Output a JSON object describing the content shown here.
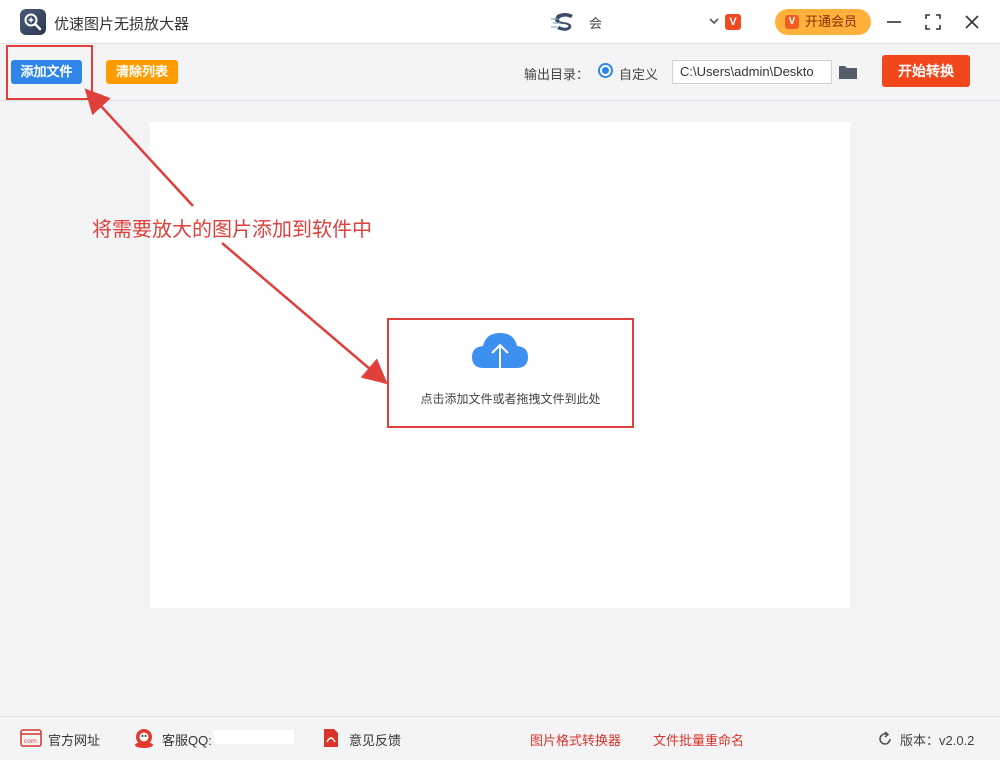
{
  "window": {
    "title": "优速图片无损放大器",
    "user_name": "会",
    "vip_button": "开通会员",
    "vip_icon_letter": "V",
    "badge_letter": "V"
  },
  "toolbar": {
    "add_files": "添加文件",
    "clear_list": "清除列表",
    "output_dir_label": "输出目录：",
    "radio_custom": "自定义",
    "output_path": "C:\\Users\\admin\\Deskto",
    "start_button": "开始转换"
  },
  "drop_area": {
    "hint": "点击添加文件或者拖拽文件到此处"
  },
  "annotation": {
    "text": "将需要放大的图片添加到软件中",
    "color": "#e0403b"
  },
  "footer": {
    "website": "官方网址",
    "qq": "客服QQ:",
    "feedback": "意见反馈",
    "format_converter": "图片格式转换器",
    "batch_rename": "文件批量重命名",
    "version": "版本：v2.0.2"
  },
  "colors": {
    "primary_blue": "#2f86e8",
    "orange": "#ff9d00",
    "start_red": "#f2461c",
    "vip_gold": "#ffb13b"
  }
}
